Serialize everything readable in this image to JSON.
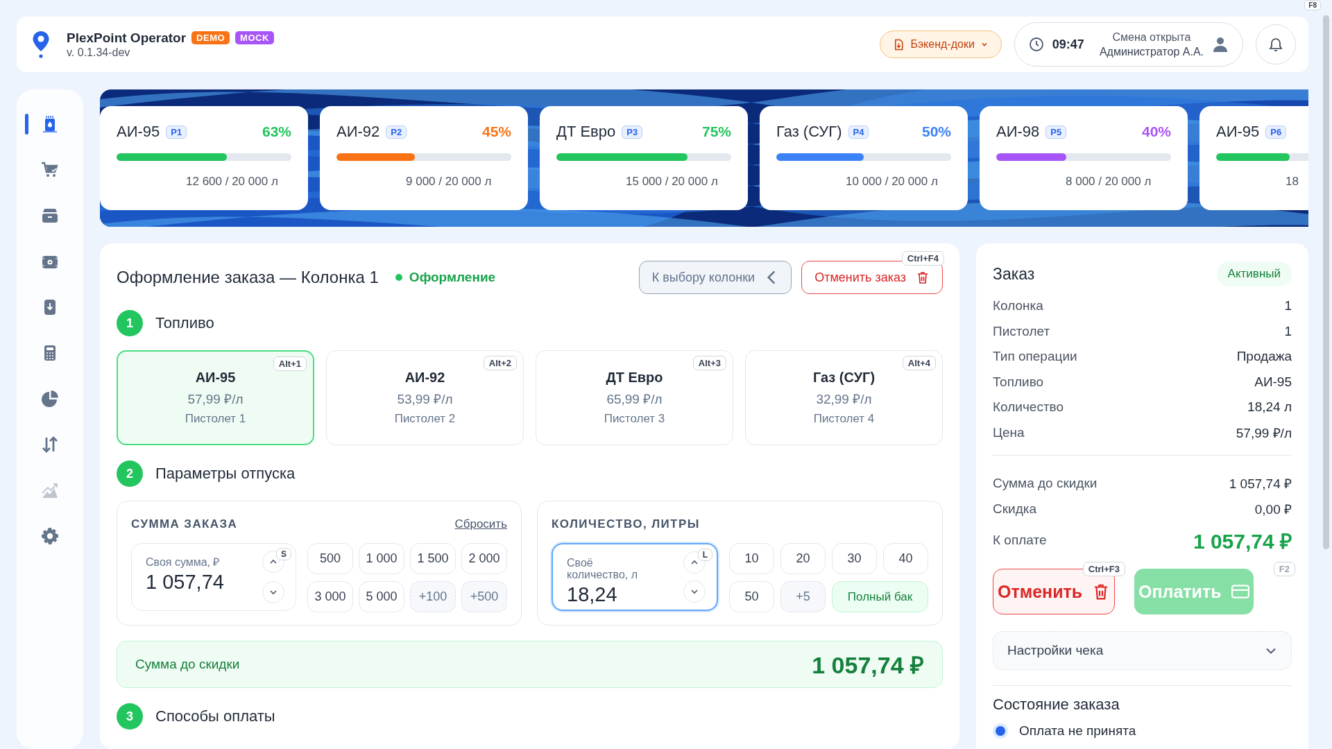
{
  "header": {
    "app_name": "PlexPoint Operator",
    "badges": [
      {
        "label": "DEMO",
        "color": "#f97316"
      },
      {
        "label": "MOCK",
        "color": "#a855f7"
      }
    ],
    "version": "v. 0.1.34-dev",
    "docs_button": "Бэкенд-доки",
    "clock": "09:47",
    "shift_status": "Смена открыта",
    "operator": "Администратор А.А.",
    "hotkey": "F8"
  },
  "sidebar": {
    "items": [
      {
        "selected": true,
        "disabled": false
      },
      {
        "selected": false,
        "disabled": false
      },
      {
        "selected": false,
        "disabled": false
      },
      {
        "selected": false,
        "disabled": false
      },
      {
        "selected": false,
        "disabled": false
      },
      {
        "selected": false,
        "disabled": false
      },
      {
        "selected": false,
        "disabled": false
      },
      {
        "selected": false,
        "disabled": false
      },
      {
        "selected": false,
        "disabled": true
      },
      {
        "selected": false,
        "disabled": false
      }
    ]
  },
  "tanks": [
    {
      "name": "АИ-95",
      "tag": "P1",
      "percent": "63%",
      "level": 0.63,
      "volume": "12 600 / 20 000 л",
      "color": "#22c55e"
    },
    {
      "name": "АИ-92",
      "tag": "P2",
      "percent": "45%",
      "level": 0.45,
      "volume": "9 000 / 20 000 л",
      "color": "#f97316"
    },
    {
      "name": "ДТ Евро",
      "tag": "P3",
      "percent": "75%",
      "level": 0.75,
      "volume": "15 000 / 20 000 л",
      "color": "#22c55e"
    },
    {
      "name": "Газ (СУГ)",
      "tag": "P4",
      "percent": "50%",
      "level": 0.5,
      "volume": "10 000 / 20 000 л",
      "color": "#3b82f6"
    },
    {
      "name": "АИ-98",
      "tag": "P5",
      "percent": "40%",
      "level": 0.4,
      "volume": "8 000 / 20 000 л",
      "color": "#a855f7"
    },
    {
      "name": "АИ-95",
      "tag": "P6",
      "level": 0.42,
      "volume": "18",
      "color": "#22c55e"
    }
  ],
  "order": {
    "title": "Оформление заказа — Колонка 1",
    "status": "Оформление",
    "back_button": "К выбору колонки",
    "cancel_button": "Отменить заказ",
    "cancel_hotkey": "Ctrl+F4",
    "fuel_step": {
      "number": "1",
      "title": "Топливо"
    },
    "fuels": [
      {
        "name": "АИ-95",
        "price": "57,99 ₽/л",
        "pistol": "Пистолет 1",
        "hotkey": "Alt+1",
        "selected": true
      },
      {
        "name": "АИ-92",
        "price": "53,99 ₽/л",
        "pistol": "Пистолет 2",
        "hotkey": "Alt+2",
        "selected": false
      },
      {
        "name": "ДТ Евро",
        "price": "65,99 ₽/л",
        "pistol": "Пистолет 3",
        "hotkey": "Alt+3",
        "selected": false
      },
      {
        "name": "Газ (СУГ)",
        "price": "32,99 ₽/л",
        "pistol": "Пистолет 4",
        "hotkey": "Alt+4",
        "selected": false
      }
    ],
    "params_step": {
      "number": "2",
      "title": "Параметры отпуска"
    },
    "amount": {
      "title": "СУММА ЗАКАЗА",
      "reset": "Сбросить",
      "field_label": "Своя сумма, ₽",
      "value": "1 057,74",
      "hotkey": "S",
      "focused": false,
      "presets": [
        {
          "label": "500",
          "kind": "value"
        },
        {
          "label": "1 000",
          "kind": "value"
        },
        {
          "label": "1 500",
          "kind": "value"
        },
        {
          "label": "2 000",
          "kind": "value"
        },
        {
          "label": "3 000",
          "kind": "value"
        },
        {
          "label": "5 000",
          "kind": "value"
        },
        {
          "label": "+100",
          "kind": "step"
        },
        {
          "label": "+500",
          "kind": "step"
        }
      ]
    },
    "quantity": {
      "title": "КОЛИЧЕСТВО, ЛИТРЫ",
      "field_label": "Своё количество, л",
      "value": "18,24",
      "hotkey": "L",
      "focused": true,
      "presets": [
        {
          "label": "10",
          "kind": "value"
        },
        {
          "label": "20",
          "kind": "value"
        },
        {
          "label": "30",
          "kind": "value"
        },
        {
          "label": "40",
          "kind": "value"
        },
        {
          "label": "50",
          "kind": "value"
        },
        {
          "label": "+5",
          "kind": "step"
        },
        {
          "label": "Полный бак",
          "kind": "full"
        }
      ]
    },
    "subtotal": {
      "label": "Сумма до скидки",
      "value": "1 057,74 ₽"
    },
    "payment_step": {
      "number": "3",
      "title": "Способы оплаты"
    }
  },
  "summary": {
    "title": "Заказ",
    "badge": "Активный",
    "details": [
      {
        "label": "Колонка",
        "value": "1"
      },
      {
        "label": "Пистолет",
        "value": "1"
      },
      {
        "label": "Тип операции",
        "value": "Продажа"
      },
      {
        "label": "Топливо",
        "value": "АИ-95"
      },
      {
        "label": "Количество",
        "value": "18,24 л"
      },
      {
        "label": "Цена",
        "value": "57,99 ₽/л"
      }
    ],
    "totals": [
      {
        "label": "Сумма до скидки",
        "value": "1 057,74 ₽"
      },
      {
        "label": "Скидка",
        "value": "0,00 ₽"
      }
    ],
    "due": {
      "label": "К оплате",
      "value": "1 057,74 ₽"
    },
    "cancel_button": {
      "label": "Отменить",
      "hotkey": "Ctrl+F3"
    },
    "pay_button": {
      "label": "Оплатить",
      "hotkey": "F2",
      "disabled": true
    },
    "receipt_settings": {
      "label": "Настройки чека",
      "expanded": false
    },
    "state_title": "Состояние заказа",
    "states": [
      {
        "label": "Оплата не принята",
        "selected": true
      }
    ]
  }
}
